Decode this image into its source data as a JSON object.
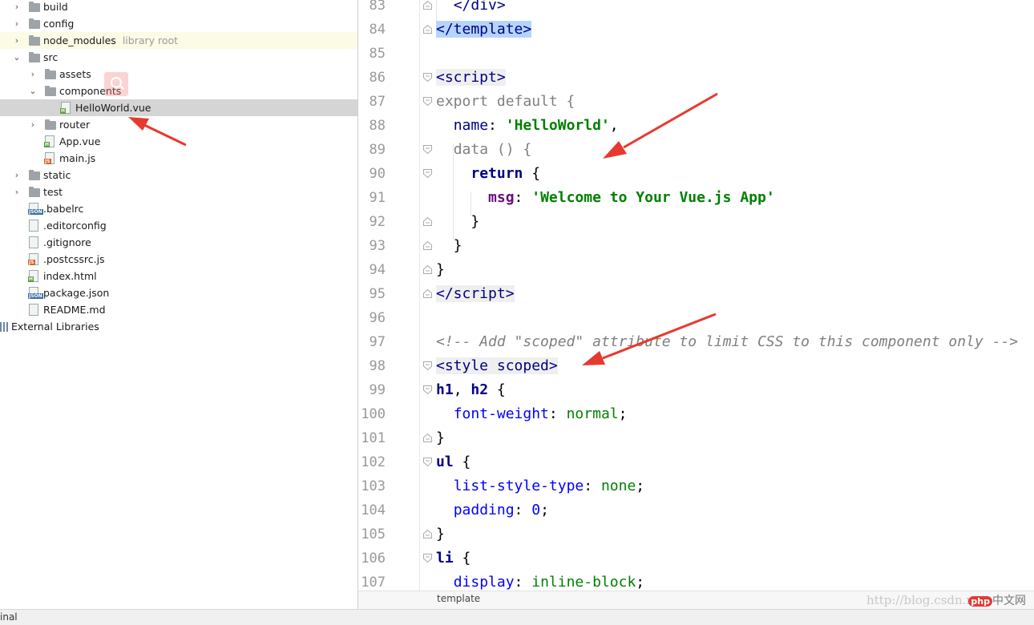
{
  "tree": {
    "items": [
      {
        "label": "build",
        "hint": "",
        "type": "folder",
        "depth": 1,
        "arrow": "›"
      },
      {
        "label": "config",
        "hint": "",
        "type": "folder",
        "depth": 1,
        "arrow": "›"
      },
      {
        "label": "node_modules",
        "hint": "library root",
        "type": "folder",
        "depth": 1,
        "arrow": "›"
      },
      {
        "label": "src",
        "hint": "",
        "type": "folder",
        "depth": 1,
        "arrow": "⌄"
      },
      {
        "label": "assets",
        "hint": "",
        "type": "folder",
        "depth": 2,
        "arrow": "›"
      },
      {
        "label": "components",
        "hint": "",
        "type": "folder",
        "depth": 2,
        "arrow": "⌄"
      },
      {
        "label": "HelloWorld.vue",
        "hint": "",
        "type": "vue",
        "depth": 3,
        "arrow": ""
      },
      {
        "label": "router",
        "hint": "",
        "type": "folder",
        "depth": 2,
        "arrow": "›"
      },
      {
        "label": "App.vue",
        "hint": "",
        "type": "vue",
        "depth": 2,
        "arrow": ""
      },
      {
        "label": "main.js",
        "hint": "",
        "type": "js",
        "depth": 2,
        "arrow": ""
      },
      {
        "label": "static",
        "hint": "",
        "type": "folder",
        "depth": 1,
        "arrow": "›"
      },
      {
        "label": "test",
        "hint": "",
        "type": "folder",
        "depth": 1,
        "arrow": "›"
      },
      {
        "label": ".babelrc",
        "hint": "",
        "type": "json",
        "depth": 1,
        "arrow": ""
      },
      {
        "label": ".editorconfig",
        "hint": "",
        "type": "txt",
        "depth": 1,
        "arrow": ""
      },
      {
        "label": ".gitignore",
        "hint": "",
        "type": "txt",
        "depth": 1,
        "arrow": ""
      },
      {
        "label": ".postcssrc.js",
        "hint": "",
        "type": "js",
        "depth": 1,
        "arrow": ""
      },
      {
        "label": "index.html",
        "hint": "",
        "type": "html",
        "depth": 1,
        "arrow": ""
      },
      {
        "label": "package.json",
        "hint": "",
        "type": "json",
        "depth": 1,
        "arrow": ""
      },
      {
        "label": "README.md",
        "hint": "",
        "type": "txt",
        "depth": 1,
        "arrow": ""
      },
      {
        "label": "External Libraries",
        "hint": "",
        "type": "lib",
        "depth": 0,
        "arrow": ""
      }
    ],
    "file_tags": {
      "vue": "H",
      "html": "H",
      "js": "JS",
      "json": "JSON",
      "txt": ""
    }
  },
  "editor": {
    "line_numbers": [
      "83",
      "84",
      "85",
      "86",
      "87",
      "88",
      "89",
      "90",
      "91",
      "92",
      "93",
      "94",
      "95",
      "96",
      "97",
      "98",
      "99",
      "100",
      "101",
      "102",
      "103",
      "104",
      "105",
      "106",
      "107"
    ],
    "breadcrumb": "template"
  },
  "status_bar": {
    "terminal_tab": "inal"
  },
  "watermark": {
    "url": "http://blog.csdn.net",
    "logo_php": "php",
    "logo_cn": "中文网"
  },
  "colors": {
    "selection": "#d5d5d5",
    "tag_highlight": "#b5d5ff",
    "annotation_arrow": "#e8392f"
  }
}
